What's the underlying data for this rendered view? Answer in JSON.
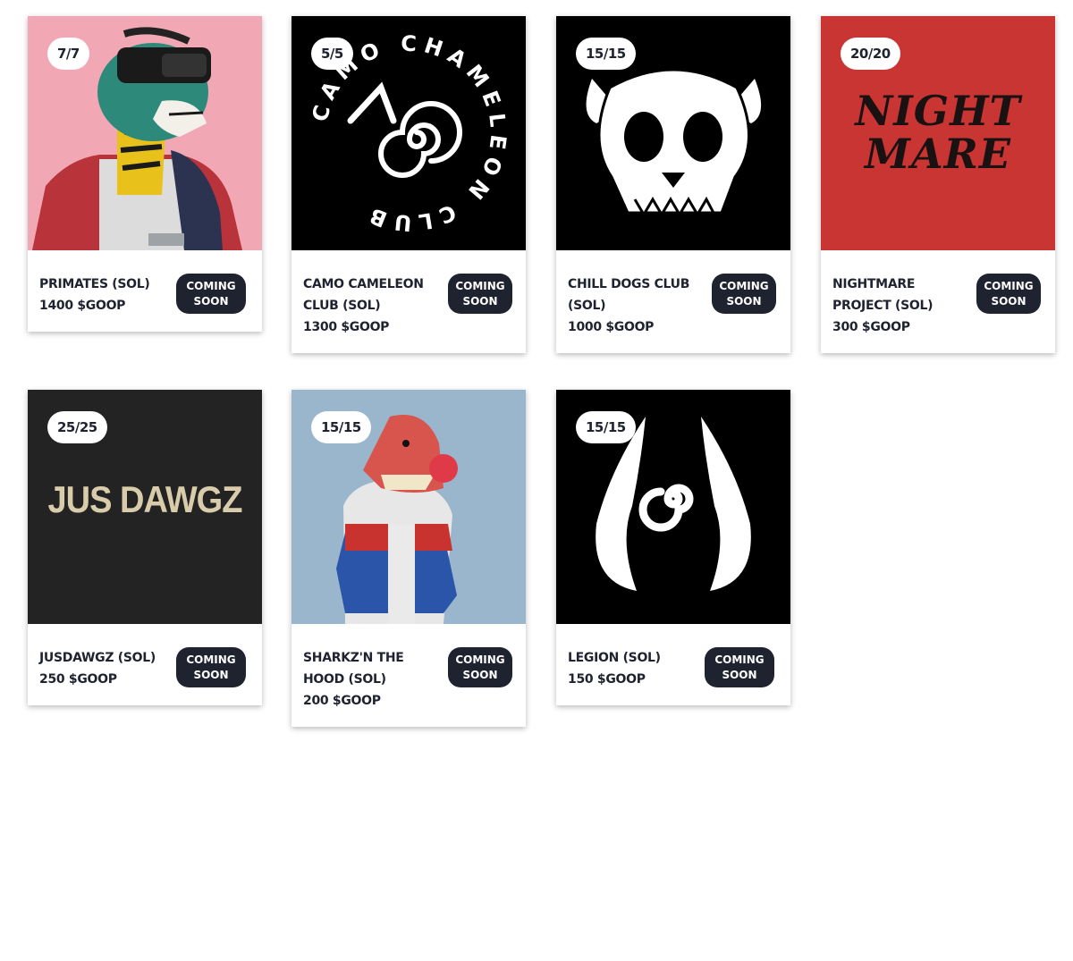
{
  "button_label": "COMING SOON",
  "cards": [
    {
      "name": "PRIMATES (SOL)",
      "price": "1400 $GOOP",
      "count": "7/7",
      "art_color": "#f2a8b4"
    },
    {
      "name": "CAMO CAMELEON CLUB (SOL)",
      "price": "1300 $GOOP",
      "count": "5/5",
      "art_color": "#000000",
      "logo_text": "CAMO CHAMELEON CLUB"
    },
    {
      "name": "CHILL DOGS CLUB (SOL)",
      "price": "1000 $GOOP",
      "count": "15/15",
      "art_color": "#000000"
    },
    {
      "name": "NIGHTMARE PROJECT (SOL)",
      "price": "300 $GOOP",
      "count": "20/20",
      "art_color": "#c93532",
      "logo_text": "NIGHT MARE"
    },
    {
      "name": "JUSDAWGZ (SOL)",
      "price": "250 $GOOP",
      "count": "25/25",
      "art_color": "#232323",
      "logo_text": "JUS DAWGZ"
    },
    {
      "name": "SHARKZ'N THE HOOD (SOL)",
      "price": "200 $GOOP",
      "count": "15/15",
      "art_color": "#9ab6cc"
    },
    {
      "name": "LEGION (SOL)",
      "price": "150 $GOOP",
      "count": "15/15",
      "art_color": "#000000"
    }
  ],
  "colors": {
    "button_bg": "#1f2330",
    "text": "#1f2330"
  }
}
